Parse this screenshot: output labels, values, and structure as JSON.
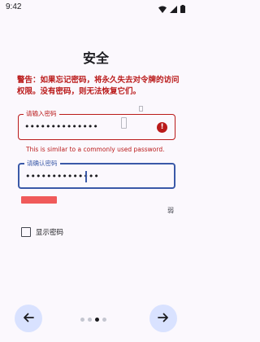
{
  "status_bar": {
    "time": "9:42",
    "icons": [
      "wifi-icon",
      "signal-icon",
      "battery-icon"
    ]
  },
  "page": {
    "title": "安全",
    "warning": "警告：如果忘记密码，将永久失去对令牌的访问权限。没有密码，则无法恢复它们。"
  },
  "password_field": {
    "label": "请输入密码",
    "value": "••••••••••••••",
    "error": "This is similar to a commonly used password."
  },
  "confirm_field": {
    "label": "请确认密码",
    "value": "••••••••••••••"
  },
  "strength": {
    "label": "弱",
    "level": 0.25,
    "color": "#f05a5a"
  },
  "show_password": {
    "label": "显示密码",
    "checked": false
  },
  "pager": {
    "total": 4,
    "current": 3
  },
  "colors": {
    "error": "#ba1a1a",
    "accent": "#3a59a8",
    "nav_button": "#d9e2ff"
  }
}
